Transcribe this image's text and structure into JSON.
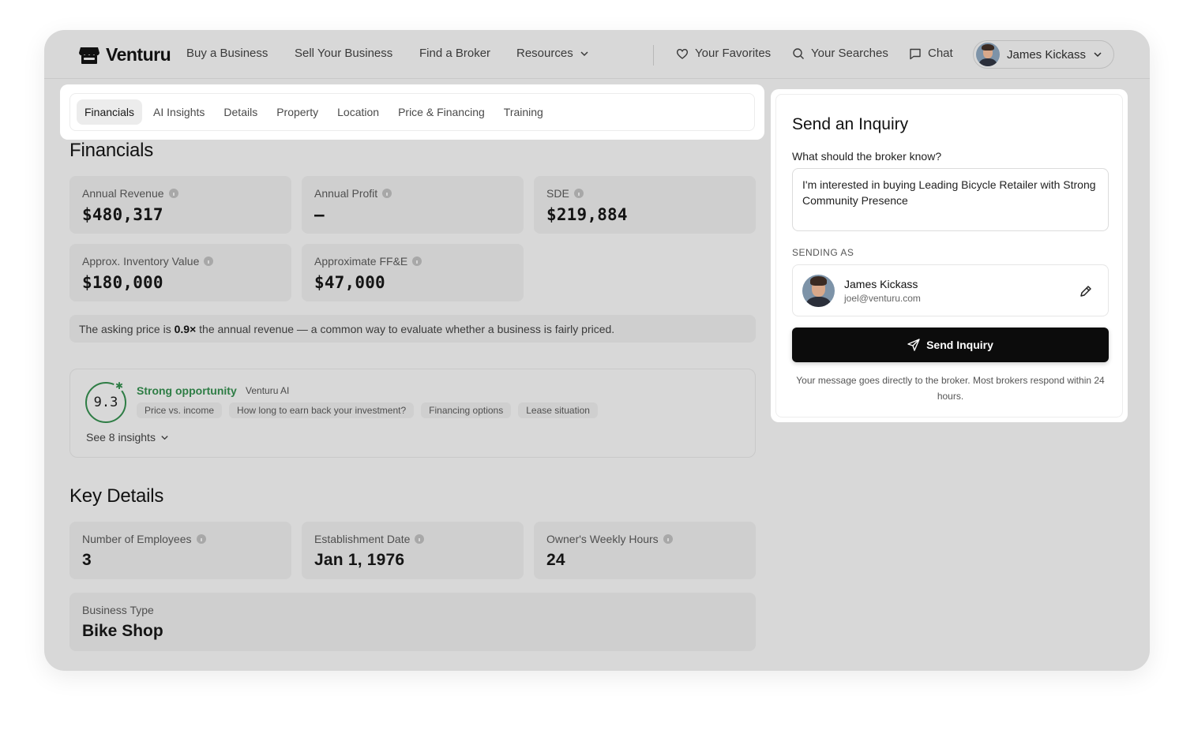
{
  "nav": {
    "brand": "Venturu",
    "links": [
      "Buy a Business",
      "Sell Your Business",
      "Find a Broker",
      "Resources"
    ],
    "favorites": "Your Favorites",
    "searches": "Your Searches",
    "chat": "Chat",
    "user_name": "James Kickass"
  },
  "tabs": [
    "Financials",
    "AI Insights",
    "Details",
    "Property",
    "Location",
    "Price & Financing",
    "Training"
  ],
  "financials": {
    "heading": "Financials",
    "stats": [
      {
        "label": "Annual Revenue",
        "value": "$480,317"
      },
      {
        "label": "Annual Profit",
        "value": "—"
      },
      {
        "label": "SDE",
        "value": "$219,884"
      },
      {
        "label": "Approx. Inventory Value",
        "value": "$180,000"
      },
      {
        "label": "Approximate FF&E",
        "value": "$47,000"
      }
    ],
    "note_prefix": "The asking price is",
    "note_value": "0.9×",
    "note_suffix": "the annual revenue — a common way to evaluate whether a business is fairly priced."
  },
  "ai": {
    "score": "9.3",
    "title": "Strong opportunity",
    "source": "Venturu AI",
    "chips": [
      "Price vs. income",
      "How long to earn back your investment?",
      "Financing options",
      "Lease situation"
    ],
    "see_more": "See 8 insights"
  },
  "key_details": {
    "heading": "Key Details",
    "stats": [
      {
        "label": "Number of Employees",
        "value": "3"
      },
      {
        "label": "Establishment Date",
        "value": "Jan 1, 1976"
      },
      {
        "label": "Owner's Weekly Hours",
        "value": "24"
      }
    ],
    "business_type_label": "Business Type",
    "business_type_value": "Bike Shop"
  },
  "inquiry": {
    "title": "Send an Inquiry",
    "question": "What should the broker know?",
    "message": "I'm interested in buying Leading Bicycle Retailer with Strong Community Presence",
    "sending_as": "SENDING AS",
    "sender_name": "James Kickass",
    "sender_email": "joel@venturu.com",
    "send_label": "Send Inquiry",
    "footer": "Your message goes directly to the broker. Most brokers respond within 24 hours."
  }
}
